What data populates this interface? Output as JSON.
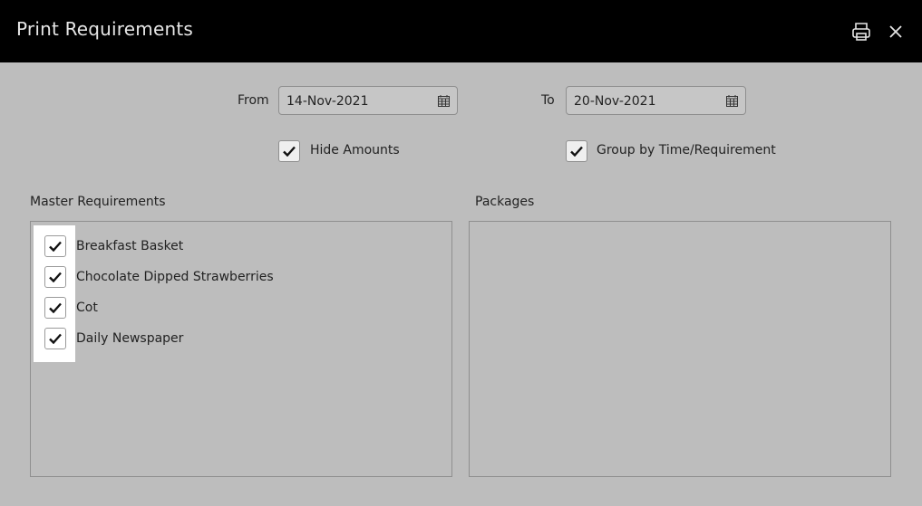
{
  "header": {
    "title": "Print Requirements",
    "icons": {
      "print": "printer-icon",
      "close": "close-icon"
    }
  },
  "filters": {
    "from_label": "From",
    "from_value": "14-Nov-2021",
    "to_label": "To",
    "to_value": "20-Nov-2021",
    "hide_amounts": {
      "label": "Hide Amounts",
      "checked": true
    },
    "group_by": {
      "label": "Group by Time/Requirement",
      "checked": true
    }
  },
  "master_requirements": {
    "heading": "Master Requirements",
    "items": [
      {
        "label": "Breakfast Basket",
        "checked": true
      },
      {
        "label": "Chocolate Dipped Strawberries",
        "checked": true
      },
      {
        "label": "Cot",
        "checked": true
      },
      {
        "label": "Daily Newspaper",
        "checked": true
      }
    ]
  },
  "packages": {
    "heading": "Packages",
    "items": []
  },
  "colors": {
    "titlebar": "#000000",
    "background": "#bdbdbd",
    "title_text": "#e6e6e6"
  }
}
